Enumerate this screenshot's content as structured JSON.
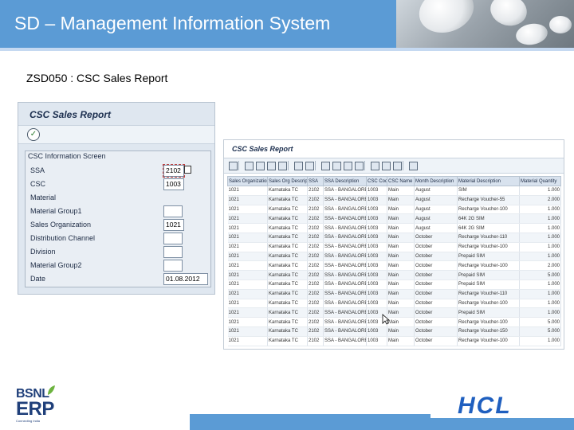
{
  "slide": {
    "title": "SD – Management Information System",
    "subtitle": "ZSD050 : CSC Sales Report"
  },
  "selection_screen": {
    "title": "CSC Sales Report",
    "execute_icon": "execute-icon",
    "group_title": "CSC Information Screen",
    "fields": [
      {
        "label": "SSA",
        "value": "2102"
      },
      {
        "label": "CSC",
        "value": "1003"
      },
      {
        "label": "Material",
        "value": ""
      },
      {
        "label": "Material Group1",
        "value": ""
      },
      {
        "label": "Sales Organization",
        "value": "1021"
      },
      {
        "label": "Distribution Channel",
        "value": ""
      },
      {
        "label": "Division",
        "value": ""
      },
      {
        "label": "Material Group2",
        "value": ""
      },
      {
        "label": "Date",
        "value": "01.08.2012"
      }
    ]
  },
  "report": {
    "title": "CSC Sales Report",
    "toolbar_icons": [
      "details-icon",
      "sort-asc-icon",
      "sort-desc-icon",
      "filter-icon",
      "sum-icon",
      "subtotal-icon",
      "print-icon",
      "view-icon",
      "export-icon",
      "mail-icon",
      "graph-icon",
      "layout-icon",
      "select-layout-icon",
      "save-layout-icon",
      "info-icon"
    ],
    "columns": [
      "Sales Organization",
      "Sales Org Descript",
      "SSA",
      "SSA Description",
      "CSC Code",
      "CSC Name",
      "Month Description",
      "Material Description",
      "Material Quantity"
    ],
    "rows": [
      [
        "1021",
        "Karnataka TC",
        "2102",
        "SSA - BANGALORE",
        "1003",
        "Main",
        "August",
        "SIM",
        "1.000"
      ],
      [
        "1021",
        "Karnataka TC",
        "2102",
        "SSA - BANGALORE",
        "1003",
        "Main",
        "August",
        "Recharge Voucher-55",
        "2.000"
      ],
      [
        "1021",
        "Karnataka TC",
        "2102",
        "SSA - BANGALORE",
        "1003",
        "Main",
        "August",
        "Recharge Voucher-100",
        "1.000"
      ],
      [
        "1021",
        "Karnataka TC",
        "2102",
        "SSA - BANGALORE",
        "1003",
        "Main",
        "August",
        "64K 2G SIM",
        "1.000"
      ],
      [
        "1021",
        "Karnataka TC",
        "2102",
        "SSA - BANGALORE",
        "1003",
        "Main",
        "August",
        "64K 2G SIM",
        "1.000"
      ],
      [
        "1021",
        "Karnataka TC",
        "2102",
        "SSA - BANGALORE",
        "1003",
        "Main",
        "October",
        "Recharge Voucher-110",
        "1.000"
      ],
      [
        "1021",
        "Karnataka TC",
        "2102",
        "SSA - BANGALORE",
        "1003",
        "Main",
        "October",
        "Recharge Voucher-100",
        "1.000"
      ],
      [
        "1021",
        "Karnataka TC",
        "2102",
        "SSA - BANGALORE",
        "1003",
        "Main",
        "October",
        "Prepaid SIM",
        "1.000"
      ],
      [
        "1021",
        "Karnataka TC",
        "2102",
        "SSA - BANGALORE",
        "1003",
        "Main",
        "October",
        "Recharge Voucher-100",
        "2.000"
      ],
      [
        "1021",
        "Karnataka TC",
        "2102",
        "SSA - BANGALORE",
        "1003",
        "Main",
        "October",
        "Prepaid SIM",
        "5.000"
      ],
      [
        "1021",
        "Karnataka TC",
        "2102",
        "SSA - BANGALORE",
        "1003",
        "Main",
        "October",
        "Prepaid SIM",
        "1.000"
      ],
      [
        "1021",
        "Karnataka TC",
        "2102",
        "SSA - BANGALORE",
        "1003",
        "Main",
        "October",
        "Recharge Voucher-110",
        "1.000"
      ],
      [
        "1021",
        "Karnataka TC",
        "2102",
        "SSA - BANGALORE",
        "1003",
        "Main",
        "October",
        "Recharge Voucher-100",
        "1.000"
      ],
      [
        "1021",
        "Karnataka TC",
        "2102",
        "SSA - BANGALORE",
        "1003",
        "Main",
        "October",
        "Prepaid SIM",
        "1.000"
      ],
      [
        "1021",
        "Karnataka TC",
        "2102",
        "SSA - BANGALORE",
        "1003",
        "Main",
        "October",
        "Recharge Voucher-100",
        "5.000"
      ],
      [
        "1021",
        "Karnataka TC",
        "2102",
        "SSA - BANGALORE",
        "1003",
        "Main",
        "October",
        "Recharge Voucher-150",
        "5.000"
      ],
      [
        "1021",
        "Karnataka TC",
        "2102",
        "SSA - BANGALORE",
        "1003",
        "Main",
        "October",
        "Recharge Voucher-100",
        "1.000"
      ]
    ]
  },
  "logos": {
    "bsnl": "BSNL",
    "erp": "ERP",
    "tagline": "Connecting India",
    "hcl": "HCL"
  },
  "colors": {
    "header_blue": "#5b9bd5",
    "sap_panel": "#dfe7f0",
    "hcl_blue": "#1f5fbf",
    "bsnl_navy": "#1f3f7a"
  }
}
